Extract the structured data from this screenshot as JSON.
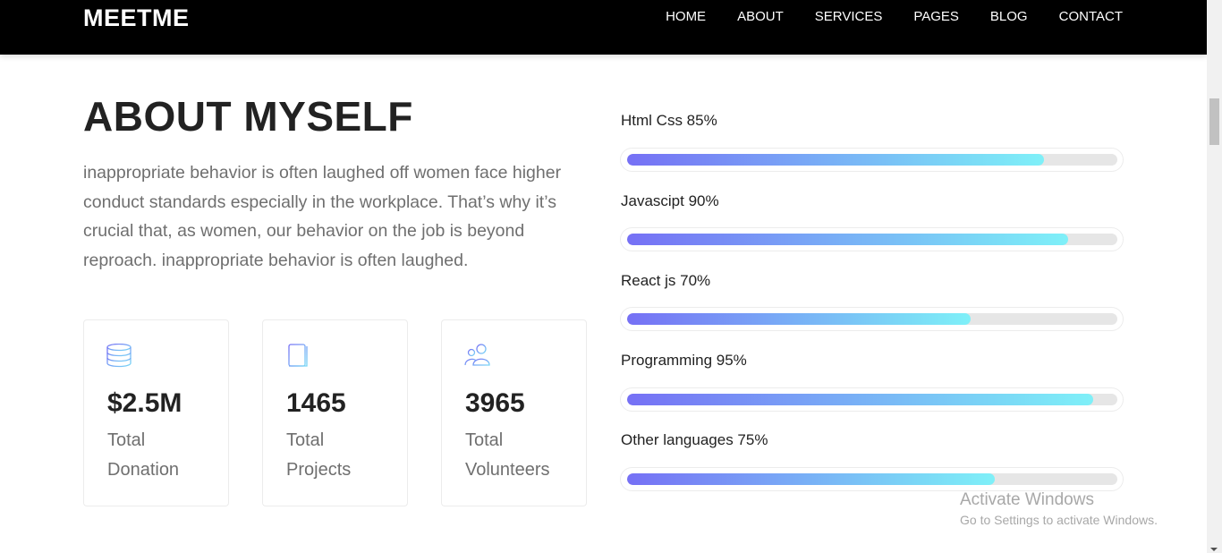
{
  "header": {
    "logo": "MEETME",
    "nav": [
      "HOME",
      "ABOUT",
      "SERVICES",
      "PAGES",
      "BLOG",
      "CONTACT"
    ]
  },
  "about": {
    "title": "ABOUT MYSELF",
    "paragraph": "inappropriate behavior is often laughed off women face higher conduct standards especially in the workplace. That’s why it’s crucial that, as women, our behavior on the job is beyond reproach. inappropriate behavior is often laughed."
  },
  "stats": [
    {
      "icon": "database-icon",
      "value": "$2.5M",
      "label_line1": "Total",
      "label_line2": "Donation"
    },
    {
      "icon": "book-icon",
      "value": "1465",
      "label_line1": "Total",
      "label_line2": "Projects"
    },
    {
      "icon": "users-icon",
      "value": "3965",
      "label_line1": "Total",
      "label_line2": "Volunteers"
    }
  ],
  "skills": [
    {
      "label": "Html Css 85%",
      "percent": 85
    },
    {
      "label": "Javascipt 90%",
      "percent": 90
    },
    {
      "label": "React js 70%",
      "percent": 70
    },
    {
      "label": "Programming 95%",
      "percent": 95
    },
    {
      "label": "Other languages 75%",
      "percent": 75
    }
  ],
  "colors": {
    "header_bg": "#000000",
    "progress_start": "#7670f5",
    "progress_end": "#7ff0f8",
    "icon_gradient_start": "#7670f5",
    "icon_gradient_end": "#7ad8f6"
  },
  "watermark": {
    "line1": "Activate Windows",
    "line2": "Go to Settings to activate Windows."
  }
}
